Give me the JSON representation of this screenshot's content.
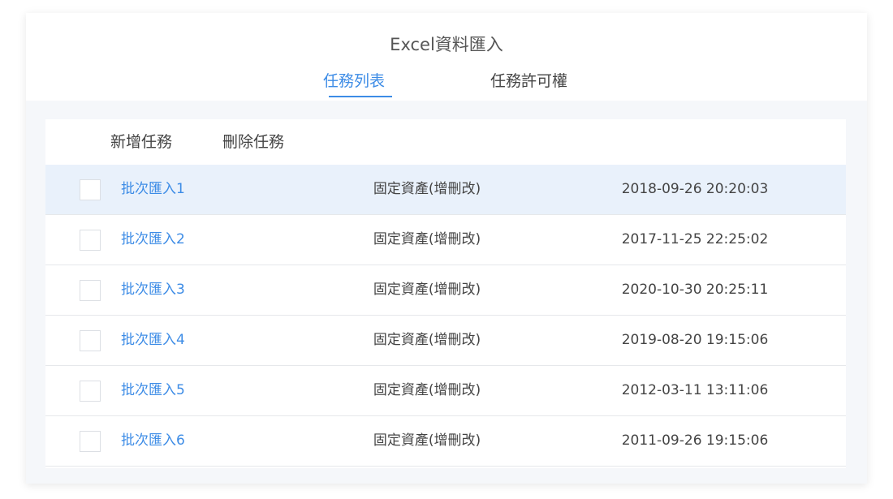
{
  "header": {
    "title": "Excel資料匯入",
    "tabs": [
      {
        "label": "任務列表",
        "active": true
      },
      {
        "label": "任務許可權",
        "active": false
      }
    ]
  },
  "toolbar": {
    "add_label": "新增任務",
    "delete_label": "刪除任務"
  },
  "colors": {
    "accent": "#3d8ce6",
    "selected_row": "#e9f1fb"
  },
  "tasks": [
    {
      "name": "批次匯入1",
      "type": "固定資產(增刪改)",
      "time": "2018-09-26 20:20:03",
      "selected": true
    },
    {
      "name": "批次匯入2",
      "type": "固定資產(增刪改)",
      "time": "2017-11-25 22:25:02",
      "selected": false
    },
    {
      "name": "批次匯入3",
      "type": "固定資產(增刪改)",
      "time": "2020-10-30 20:25:11",
      "selected": false
    },
    {
      "name": "批次匯入4",
      "type": "固定資產(增刪改)",
      "time": "2019-08-20 19:15:06",
      "selected": false
    },
    {
      "name": "批次匯入5",
      "type": "固定資產(增刪改)",
      "time": "2012-03-11 13:11:06",
      "selected": false
    },
    {
      "name": "批次匯入6",
      "type": "固定資產(增刪改)",
      "time": "2011-09-26 19:15:06",
      "selected": false
    }
  ]
}
